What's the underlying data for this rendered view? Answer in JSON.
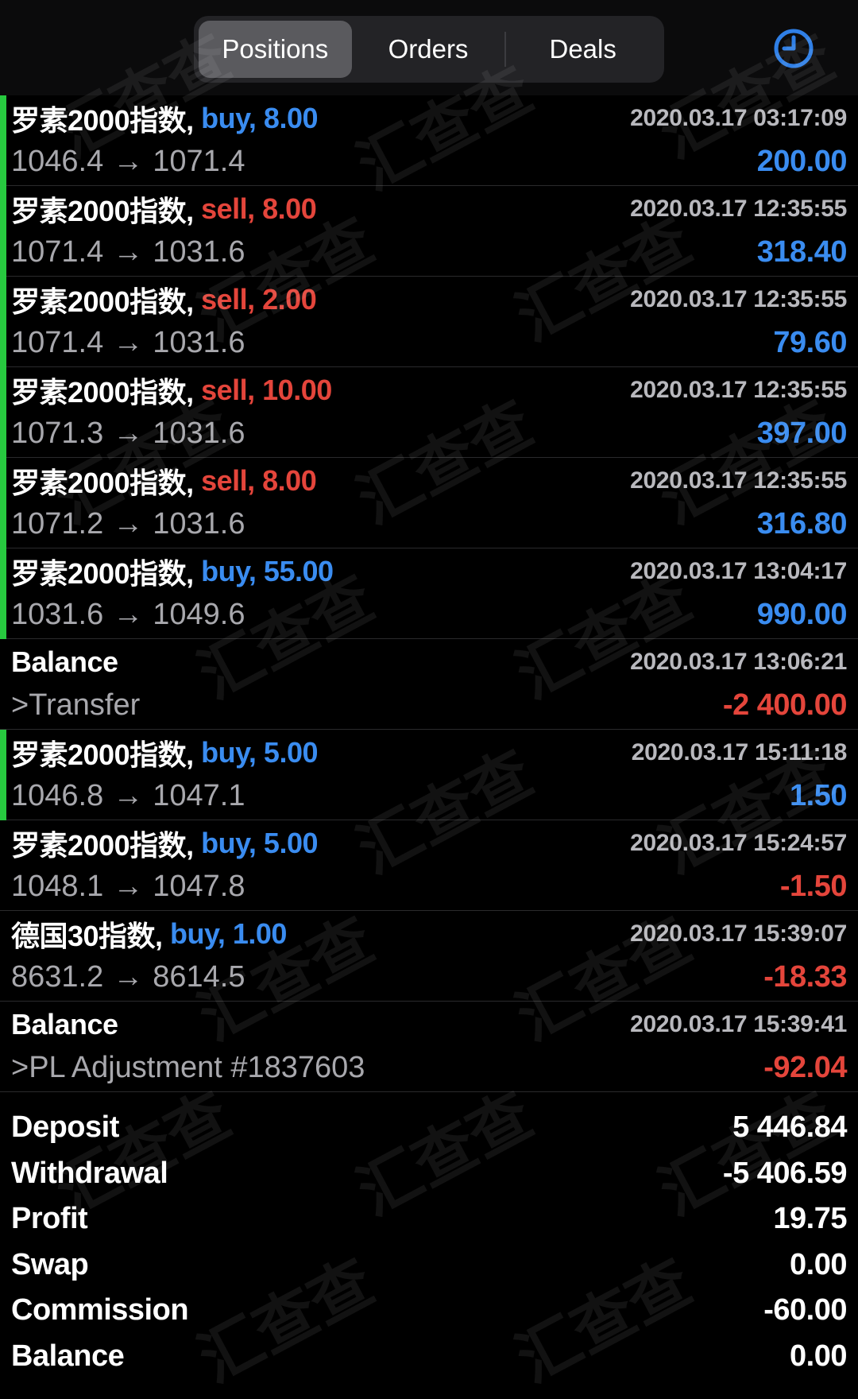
{
  "tabs": [
    {
      "label": "Positions",
      "active": true
    },
    {
      "label": "Orders",
      "active": false
    },
    {
      "label": "Deals",
      "active": false
    }
  ],
  "history_icon": "clock-icon",
  "colors": {
    "buy": "#3a8cf0",
    "sell": "#e4453b",
    "accent_green": "#27c93f",
    "background": "#000000"
  },
  "deals": [
    {
      "kind": "trade",
      "symbol": "罗素2000指数,",
      "side": "buy",
      "side_text": " buy, 8.00",
      "time": "2020.03.17 03:17:09",
      "price_open": "1046.4",
      "arrow": "→",
      "price_close": "1071.4",
      "amount": "200.00",
      "amount_sign": "pos",
      "marker": true
    },
    {
      "kind": "trade",
      "symbol": "罗素2000指数,",
      "side": "sell",
      "side_text": " sell, 8.00",
      "time": "2020.03.17 12:35:55",
      "price_open": "1071.4",
      "arrow": "→",
      "price_close": "1031.6",
      "amount": "318.40",
      "amount_sign": "pos",
      "marker": true
    },
    {
      "kind": "trade",
      "symbol": "罗素2000指数,",
      "side": "sell",
      "side_text": " sell, 2.00",
      "time": "2020.03.17 12:35:55",
      "price_open": "1071.4",
      "arrow": "→",
      "price_close": "1031.6",
      "amount": "79.60",
      "amount_sign": "pos",
      "marker": true
    },
    {
      "kind": "trade",
      "symbol": "罗素2000指数,",
      "side": "sell",
      "side_text": " sell, 10.00",
      "time": "2020.03.17 12:35:55",
      "price_open": "1071.3",
      "arrow": "→",
      "price_close": "1031.6",
      "amount": "397.00",
      "amount_sign": "pos",
      "marker": true
    },
    {
      "kind": "trade",
      "symbol": "罗素2000指数,",
      "side": "sell",
      "side_text": " sell, 8.00",
      "time": "2020.03.17 12:35:55",
      "price_open": "1071.2",
      "arrow": "→",
      "price_close": "1031.6",
      "amount": "316.80",
      "amount_sign": "pos",
      "marker": true
    },
    {
      "kind": "trade",
      "symbol": "罗素2000指数,",
      "side": "buy",
      "side_text": " buy, 55.00",
      "time": "2020.03.17 13:04:17",
      "price_open": "1031.6",
      "arrow": "→",
      "price_close": "1049.6",
      "amount": "990.00",
      "amount_sign": "pos",
      "marker": true
    },
    {
      "kind": "balance",
      "symbol": "Balance",
      "time": "2020.03.17 13:06:21",
      "comment": ">Transfer",
      "amount": "-2 400.00",
      "amount_sign": "neg",
      "marker": false
    },
    {
      "kind": "trade",
      "symbol": "罗素2000指数,",
      "side": "buy",
      "side_text": " buy, 5.00",
      "time": "2020.03.17 15:11:18",
      "price_open": "1046.8",
      "arrow": "→",
      "price_close": "1047.1",
      "amount": "1.50",
      "amount_sign": "pos",
      "marker": true
    },
    {
      "kind": "trade",
      "symbol": "罗素2000指数,",
      "side": "buy",
      "side_text": " buy, 5.00",
      "time": "2020.03.17 15:24:57",
      "price_open": "1048.1",
      "arrow": "→",
      "price_close": "1047.8",
      "amount": "-1.50",
      "amount_sign": "neg",
      "marker": false
    },
    {
      "kind": "trade",
      "symbol": "德国30指数,",
      "side": "buy",
      "side_text": " buy, 1.00",
      "time": "2020.03.17 15:39:07",
      "price_open": "8631.2",
      "arrow": "→",
      "price_close": "8614.5",
      "amount": "-18.33",
      "amount_sign": "neg",
      "marker": false
    },
    {
      "kind": "balance",
      "symbol": "Balance",
      "time": "2020.03.17 15:39:41",
      "comment": ">PL Adjustment #1837603",
      "amount": "-92.04",
      "amount_sign": "neg",
      "marker": false
    }
  ],
  "summary": [
    {
      "label": "Deposit",
      "value": "5 446.84"
    },
    {
      "label": "Withdrawal",
      "value": "-5 406.59"
    },
    {
      "label": "Profit",
      "value": "19.75"
    },
    {
      "label": "Swap",
      "value": "0.00"
    },
    {
      "label": "Commission",
      "value": "-60.00"
    },
    {
      "label": "Balance",
      "value": "0.00"
    }
  ],
  "watermark_text": "汇查查"
}
